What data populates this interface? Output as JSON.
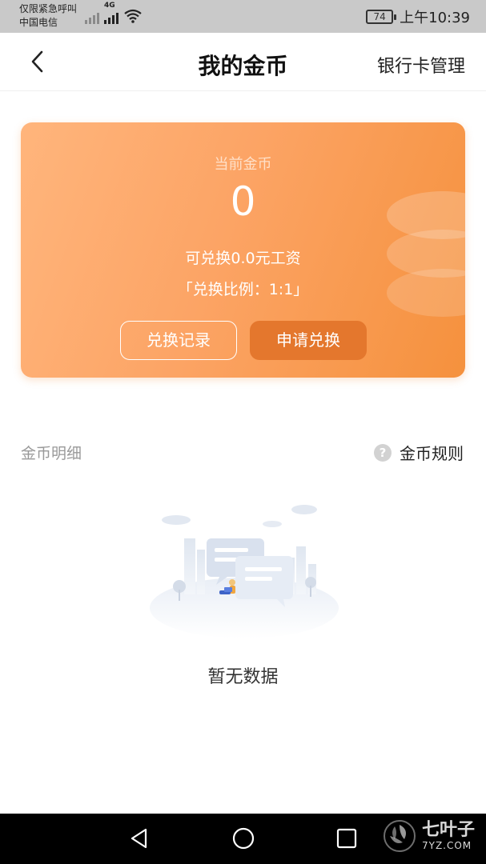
{
  "status_bar": {
    "line1": "仅限紧急呼叫",
    "line2": "中国电信",
    "network": "4G",
    "battery": "74",
    "time": "上午10:39"
  },
  "nav": {
    "title": "我的金币",
    "action": "银行卡管理"
  },
  "card": {
    "label": "当前金币",
    "value": "0",
    "exchangeable": "可兑换0.0元工资",
    "ratio": "「兑换比例：1:1」",
    "history_button": "兑换记录",
    "apply_button": "申请兑换"
  },
  "section": {
    "title": "金币明细",
    "rules_icon": "?",
    "rules_label": "金币规则"
  },
  "empty": {
    "text": "暂无数据"
  },
  "watermark": {
    "name": "七叶子",
    "domain": "7YZ.COM"
  },
  "colors": {
    "card_gradient_start": "#ffb57c",
    "card_gradient_end": "#f5913d",
    "apply_button": "#e4772d",
    "status_bar": "#c9c9c9"
  },
  "icons": [
    "back-chevron-icon",
    "help-circle-icon",
    "nav-back-icon",
    "nav-home-icon",
    "nav-recents-icon"
  ]
}
